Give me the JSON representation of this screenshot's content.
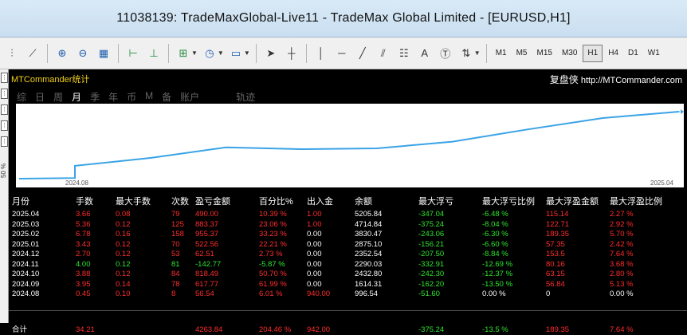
{
  "window": {
    "title": "11038139: TradeMaxGlobal-Live11 - TradeMax Global Limited - [EURUSD,H1]"
  },
  "toolbar": {
    "timeframes": [
      "M1",
      "M5",
      "M15",
      "M30",
      "H1",
      "H4",
      "D1",
      "W1"
    ],
    "active_timeframe": "H1"
  },
  "panel": {
    "title": "MTCommander统计",
    "brand_cn": "复盘侠",
    "brand_url": "http://MTCommander.com",
    "tabs": [
      "综",
      "日",
      "周",
      "月",
      "季",
      "年",
      "币",
      "M",
      "备",
      "账户",
      "轨迹"
    ],
    "active_tab": "月",
    "side_label": "50 %"
  },
  "chart_data": {
    "type": "line",
    "x": [
      "2024.08",
      "2024.09",
      "2024.10",
      "2024.11",
      "2024.12",
      "2025.01",
      "2025.02",
      "2025.03",
      "2025.04"
    ],
    "x_tick_labels": [
      "2024.08",
      "2025.04"
    ],
    "values": [
      996.54,
      1614.31,
      2432.8,
      2290.03,
      2352.54,
      2875.1,
      3830.47,
      4714.84,
      5205.84
    ],
    "color": "#3aa3e6",
    "grid": false
  },
  "table": {
    "headers": [
      "月份",
      "手数",
      "最大手数",
      "次数",
      "盈亏金额",
      "百分比%",
      "出入金",
      "余额",
      "最大浮亏",
      "最大浮亏比例",
      "最大浮盈金额",
      "最大浮盈比例"
    ],
    "rows": [
      [
        "2025.04",
        "3.66",
        "0.08",
        "79",
        "490.00",
        "10.39 %",
        "1.00",
        "5205.84",
        "-347.04",
        "-6.48 %",
        "115.14",
        "2.27 %"
      ],
      [
        "2025.03",
        "5.36",
        "0.12",
        "125",
        "883.37",
        "23.06 %",
        "1.00",
        "4714.84",
        "-375.24",
        "-8.04 %",
        "122.71",
        "2.92 %"
      ],
      [
        "2025.02",
        "6.78",
        "0.16",
        "158",
        "955.37",
        "33.23 %",
        "0.00",
        "3830.47",
        "-243.06",
        "-6.30 %",
        "189.35",
        "5.70 %"
      ],
      [
        "2025.01",
        "3.43",
        "0.12",
        "70",
        "522.56",
        "22.21 %",
        "0.00",
        "2875.10",
        "-156.21",
        "-6.60 %",
        "57.35",
        "2.42 %"
      ],
      [
        "2024.12",
        "2.70",
        "0.12",
        "53",
        "62.51",
        "2.73 %",
        "0.00",
        "2352.54",
        "-207.50",
        "-8.84 %",
        "153.5",
        "7.64 %"
      ],
      [
        "2024.11",
        "4.00",
        "0.12",
        "81",
        "-142.77",
        "-5.87 %",
        "0.00",
        "2290.03",
        "-332.91",
        "-12.69 %",
        "80.16",
        "3.68 %"
      ],
      [
        "2024.10",
        "3.88",
        "0.12",
        "84",
        "818.49",
        "50.70 %",
        "0.00",
        "2432.80",
        "-242.30",
        "-12.37 %",
        "63.15",
        "2.80 %"
      ],
      [
        "2024.09",
        "3.95",
        "0.14",
        "78",
        "617.77",
        "61.99 %",
        "0.00",
        "1614.31",
        "-162.20",
        "-13.50 %",
        "56.84",
        "5.13 %"
      ],
      [
        "2024.08",
        "0.45",
        "0.10",
        "8",
        "56.54",
        "6.01 %",
        "940.00",
        "996.54",
        "-51.60",
        "0.00 %",
        "0",
        "0.00 %"
      ]
    ],
    "row_colors": [
      "red",
      "red",
      "red",
      "red",
      "red",
      "green",
      "red",
      "red",
      "red"
    ],
    "summary": [
      "合计",
      "34.21",
      "",
      "",
      "4263.84",
      "204.46 %",
      "942.00",
      "",
      "-375.24",
      "-13.5 %",
      "189.35",
      "7.64 %"
    ]
  }
}
